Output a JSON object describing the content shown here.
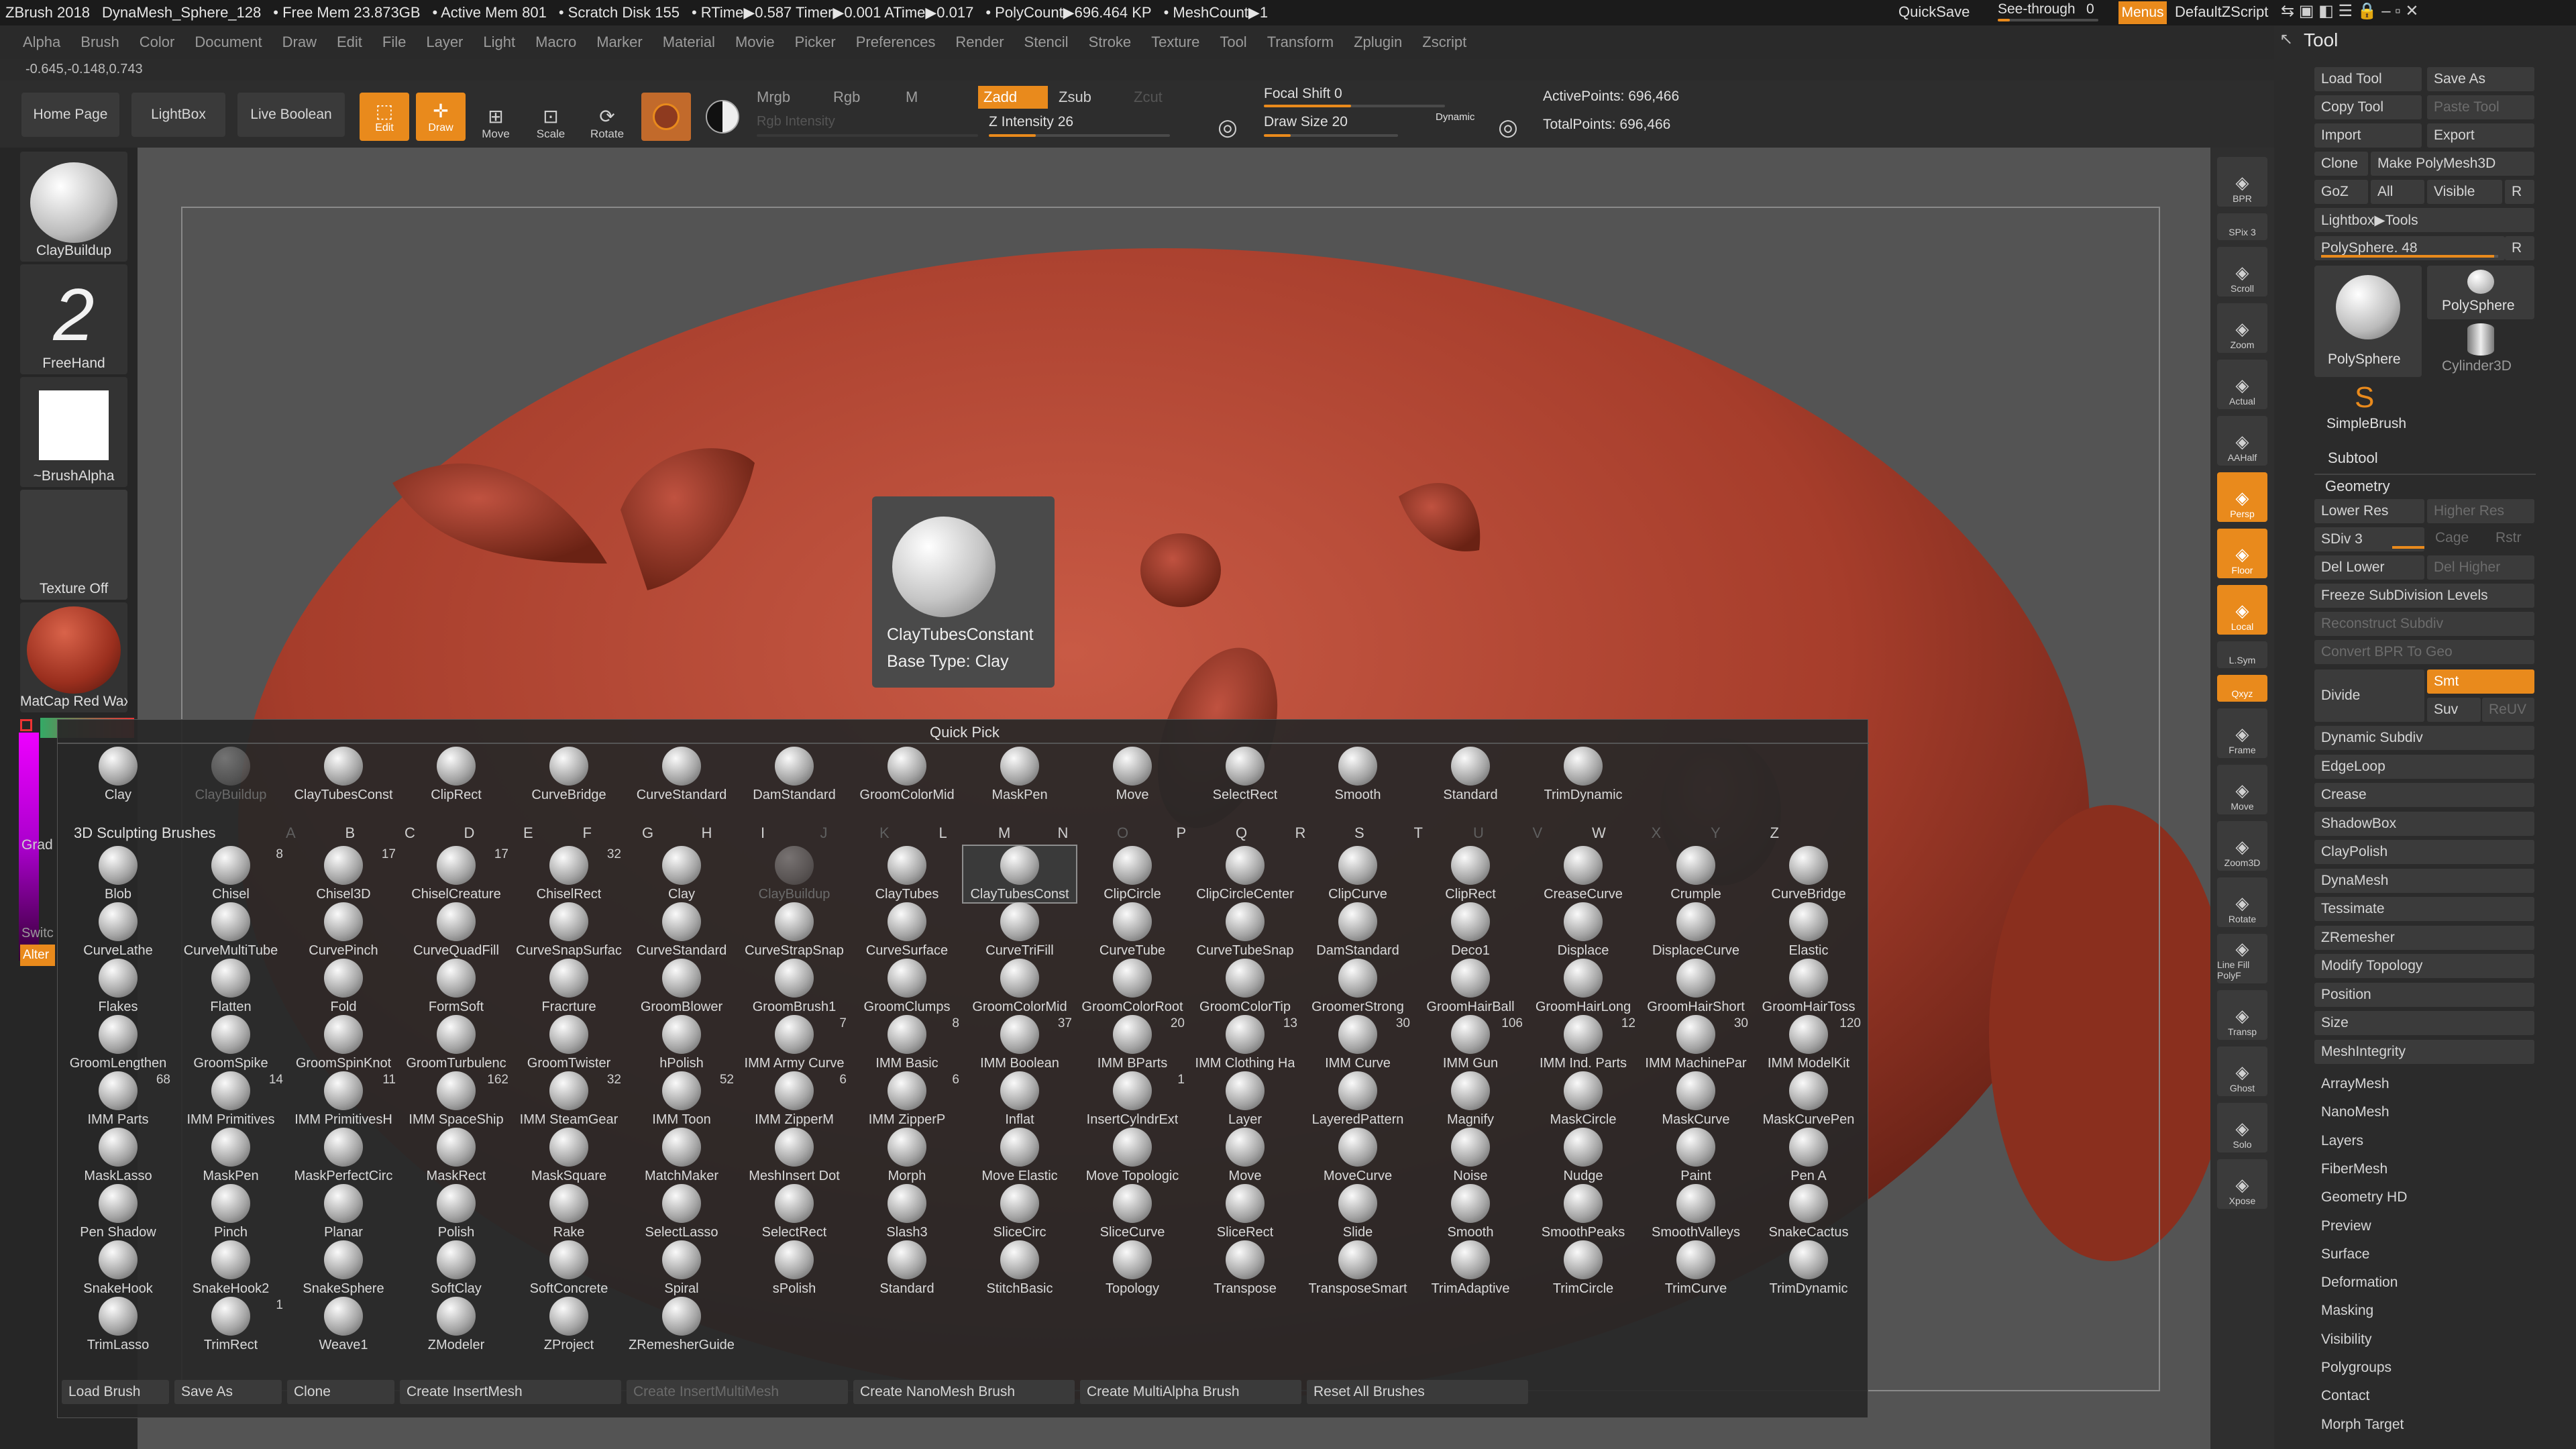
{
  "title": {
    "app": "ZBrush 2018",
    "doc": "DynaMesh_Sphere_128",
    "stats": [
      "• Free Mem 23.873GB",
      "• Active Mem 801",
      "• Scratch Disk 155",
      "• RTime▶0.587 Timer▶0.001 ATime▶0.017",
      "• PolyCount▶696.464 KP",
      "• MeshCount▶1"
    ],
    "quicksave": "QuickSave",
    "seethrough": "See-through",
    "seethrough_val": "0",
    "menus": "Menus",
    "default_zscript": "DefaultZScript"
  },
  "menubar": [
    "Alpha",
    "Brush",
    "Color",
    "Document",
    "Draw",
    "Edit",
    "File",
    "Layer",
    "Light",
    "Macro",
    "Marker",
    "Material",
    "Movie",
    "Picker",
    "Preferences",
    "Render",
    "Stencil",
    "Stroke",
    "Texture",
    "Tool",
    "Transform",
    "Zplugin",
    "Zscript"
  ],
  "coords": "-0.645,-0.148,0.743",
  "shelf": {
    "home": "Home Page",
    "lightbox": "LightBox",
    "liveboolean": "Live Boolean",
    "edit": "Edit",
    "draw": "Draw",
    "move": "Move",
    "scale": "Scale",
    "rotate": "Rotate",
    "mrgb": "Mrgb",
    "rgb": "Rgb",
    "m": "M",
    "zadd": "Zadd",
    "zsub": "Zsub",
    "zcut": "Zcut",
    "rgb_intensity": "Rgb Intensity",
    "z_intensity": "Z Intensity 26",
    "z_intensity_value": 0.26,
    "focal_shift": "Focal Shift 0",
    "draw_size": "Draw Size 20",
    "dynamic": "Dynamic",
    "active_points": "ActivePoints: 696,466",
    "total_points": "TotalPoints: 696,466"
  },
  "left": [
    {
      "label": "ClayBuildup"
    },
    {
      "label": "FreeHand"
    },
    {
      "label": "~BrushAlpha"
    },
    {
      "label": "Texture Off"
    },
    {
      "label": "MatCap Red Wax"
    }
  ],
  "left_misc": {
    "grad": "Grad",
    "switch": "Switc",
    "alternate": "Alter"
  },
  "tooltip": {
    "name": "ClayTubesConstant",
    "base": "Base Type: Clay"
  },
  "quickpick": {
    "title": "Quick Pick",
    "items": [
      "Clay",
      "ClayBuildup",
      "ClayTubesConst",
      "ClipRect",
      "CurveBridge",
      "CurveStandard",
      "DamStandard",
      "GroomColorMid",
      "MaskPen",
      "Move",
      "SelectRect",
      "Smooth",
      "Standard",
      "TrimDynamic"
    ]
  },
  "brushes": {
    "title": "3D Sculpting Brushes",
    "letters": [
      "A",
      "B",
      "C",
      "D",
      "E",
      "F",
      "G",
      "H",
      "I",
      "J",
      "K",
      "L",
      "M",
      "N",
      "O",
      "P",
      "Q",
      "R",
      "S",
      "T",
      "U",
      "V",
      "W",
      "X",
      "Y",
      "Z"
    ],
    "dim_letters": [
      "A",
      "J",
      "K",
      "O",
      "U",
      "V",
      "X",
      "Y"
    ],
    "rows": [
      [
        [
          "Blob",
          ""
        ],
        [
          "Chisel",
          "8"
        ],
        [
          "Chisel3D",
          "17"
        ],
        [
          "ChiselCreature",
          "17"
        ],
        [
          "ChiselRect",
          "32"
        ],
        [
          "Clay",
          ""
        ],
        [
          "ClayBuildup",
          ""
        ],
        [
          "ClayTubes",
          ""
        ],
        [
          "ClayTubesConst",
          ""
        ],
        [
          "ClipCircle",
          ""
        ],
        [
          "ClipCircleCenter",
          ""
        ],
        [
          "ClipCurve",
          ""
        ],
        [
          "ClipRect",
          ""
        ],
        [
          "CreaseCurve",
          ""
        ],
        [
          "Crumple",
          ""
        ],
        [
          "CurveBridge",
          ""
        ]
      ],
      [
        [
          "CurveLathe",
          ""
        ],
        [
          "CurveMultiTube",
          ""
        ],
        [
          "CurvePinch",
          ""
        ],
        [
          "CurveQuadFill",
          ""
        ],
        [
          "CurveSnapSurfac",
          ""
        ],
        [
          "CurveStandard",
          ""
        ],
        [
          "CurveStrapSnap",
          ""
        ],
        [
          "CurveSurface",
          ""
        ],
        [
          "CurveTriFill",
          ""
        ],
        [
          "CurveTube",
          ""
        ],
        [
          "CurveTubeSnap",
          ""
        ],
        [
          "DamStandard",
          ""
        ],
        [
          "Deco1",
          ""
        ],
        [
          "Displace",
          ""
        ],
        [
          "DisplaceCurve",
          ""
        ],
        [
          "Elastic",
          ""
        ]
      ],
      [
        [
          "Flakes",
          ""
        ],
        [
          "Flatten",
          ""
        ],
        [
          "Fold",
          ""
        ],
        [
          "FormSoft",
          ""
        ],
        [
          "Fracrture",
          ""
        ],
        [
          "GroomBlower",
          ""
        ],
        [
          "GroomBrush1",
          ""
        ],
        [
          "GroomClumps",
          ""
        ],
        [
          "GroomColorMid",
          ""
        ],
        [
          "GroomColorRoot",
          ""
        ],
        [
          "GroomColorTip",
          ""
        ],
        [
          "GroomerStrong",
          ""
        ],
        [
          "GroomHairBall",
          ""
        ],
        [
          "GroomHairLong",
          ""
        ],
        [
          "GroomHairShort",
          ""
        ],
        [
          "GroomHairToss",
          ""
        ]
      ],
      [
        [
          "GroomLengthen",
          ""
        ],
        [
          "GroomSpike",
          ""
        ],
        [
          "GroomSpinKnot",
          ""
        ],
        [
          "GroomTurbulenc",
          ""
        ],
        [
          "GroomTwister",
          ""
        ],
        [
          "hPolish",
          ""
        ],
        [
          "IMM Army Curve",
          "7"
        ],
        [
          "IMM Basic",
          "8"
        ],
        [
          "IMM Boolean",
          "37"
        ],
        [
          "IMM BParts",
          "20"
        ],
        [
          "IMM Clothing Ha",
          "13"
        ],
        [
          "IMM Curve",
          "30"
        ],
        [
          "IMM Gun",
          "106"
        ],
        [
          "IMM Ind. Parts",
          "12"
        ],
        [
          "IMM MachinePar",
          "30"
        ],
        [
          "IMM ModelKit",
          "120"
        ]
      ],
      [
        [
          "IMM Parts",
          "68"
        ],
        [
          "IMM Primitives",
          "14"
        ],
        [
          "IMM PrimitivesH",
          "11"
        ],
        [
          "IMM SpaceShip",
          "162"
        ],
        [
          "IMM SteamGear",
          "32"
        ],
        [
          "IMM Toon",
          "52"
        ],
        [
          "IMM ZipperM",
          "6"
        ],
        [
          "IMM ZipperP",
          "6"
        ],
        [
          "Inflat",
          ""
        ],
        [
          "InsertCylndrExt",
          "1"
        ],
        [
          "Layer",
          ""
        ],
        [
          "LayeredPattern",
          ""
        ],
        [
          "Magnify",
          ""
        ],
        [
          "MaskCircle",
          ""
        ],
        [
          "MaskCurve",
          ""
        ],
        [
          "MaskCurvePen",
          ""
        ]
      ],
      [
        [
          "MaskLasso",
          ""
        ],
        [
          "MaskPen",
          ""
        ],
        [
          "MaskPerfectCirc",
          ""
        ],
        [
          "MaskRect",
          ""
        ],
        [
          "MaskSquare",
          ""
        ],
        [
          "MatchMaker",
          ""
        ],
        [
          "MeshInsert Dot",
          ""
        ],
        [
          "Morph",
          ""
        ],
        [
          "Move Elastic",
          ""
        ],
        [
          "Move Topologic",
          ""
        ],
        [
          "Move",
          ""
        ],
        [
          "MoveCurve",
          ""
        ],
        [
          "Noise",
          ""
        ],
        [
          "Nudge",
          ""
        ],
        [
          "Paint",
          ""
        ],
        [
          "Pen A",
          ""
        ]
      ],
      [
        [
          "Pen Shadow",
          ""
        ],
        [
          "Pinch",
          ""
        ],
        [
          "Planar",
          ""
        ],
        [
          "Polish",
          ""
        ],
        [
          "Rake",
          ""
        ],
        [
          "SelectLasso",
          ""
        ],
        [
          "SelectRect",
          ""
        ],
        [
          "Slash3",
          ""
        ],
        [
          "SliceCirc",
          ""
        ],
        [
          "SliceCurve",
          ""
        ],
        [
          "SliceRect",
          ""
        ],
        [
          "Slide",
          ""
        ],
        [
          "Smooth",
          ""
        ],
        [
          "SmoothPeaks",
          ""
        ],
        [
          "SmoothValleys",
          ""
        ],
        [
          "SnakeCactus",
          ""
        ]
      ],
      [
        [
          "SnakeHook",
          ""
        ],
        [
          "SnakeHook2",
          ""
        ],
        [
          "SnakeSphere",
          ""
        ],
        [
          "SoftClay",
          ""
        ],
        [
          "SoftConcrete",
          ""
        ],
        [
          "Spiral",
          ""
        ],
        [
          "sPolish",
          ""
        ],
        [
          "Standard",
          ""
        ],
        [
          "StitchBasic",
          ""
        ],
        [
          "Topology",
          ""
        ],
        [
          "Transpose",
          ""
        ],
        [
          "TransposeSmart",
          ""
        ],
        [
          "TrimAdaptive",
          ""
        ],
        [
          "TrimCircle",
          ""
        ],
        [
          "TrimCurve",
          ""
        ],
        [
          "TrimDynamic",
          ""
        ]
      ],
      [
        [
          "TrimLasso",
          ""
        ],
        [
          "TrimRect",
          "1"
        ],
        [
          "Weave1",
          ""
        ],
        [
          "ZModeler",
          ""
        ],
        [
          "ZProject",
          ""
        ],
        [
          "ZRemesherGuide",
          ""
        ]
      ]
    ]
  },
  "popup_buttons": [
    "Load Brush",
    "Save As",
    "Clone",
    "Create InsertMesh",
    "Create InsertMultiMesh",
    "Create NanoMesh Brush",
    "Create MultiAlpha Brush",
    "Reset All Brushes"
  ],
  "rightbar": [
    "BPR",
    "SPix 3",
    "Scroll",
    "Zoom",
    "Actual",
    "AAHalf",
    "Persp",
    "Floor",
    "Local",
    "L.Sym",
    "Qxyz",
    "Frame",
    "Move",
    "Zoom3D",
    "Rotate",
    "Line Fill PolyF",
    "Transp",
    "Ghost",
    "Solo",
    "Xpose"
  ],
  "tool": {
    "title": "Tool",
    "load_tool": "Load Tool",
    "save_as": "Save As",
    "copy_tool": "Copy Tool",
    "paste_tool": "Paste Tool",
    "import": "Import",
    "export": "Export",
    "clone": "Clone",
    "make_polymesh": "Make PolyMesh3D",
    "goz": "GoZ",
    "all": "All",
    "visible": "Visible",
    "r": "R",
    "lightbox_tools": "Lightbox▶Tools",
    "polysphere_slider": "PolySphere. 48",
    "thumbs": [
      "PolySphere",
      "PolySphere",
      "Cylinder3D",
      "SimpleBrush"
    ],
    "subtool": "Subtool",
    "geometry": "Geometry",
    "lower_res": "Lower Res",
    "higher_res": "Higher Res",
    "sdiv": "SDiv 3",
    "cage": "Cage",
    "rstr": "Rstr",
    "del_lower": "Del Lower",
    "del_higher": "Del Higher",
    "freeze": "Freeze SubDivision Levels",
    "reconstruct": "Reconstruct Subdiv",
    "convert_bpr": "Convert BPR To Geo",
    "divide": "Divide",
    "smt": "Smt",
    "suv": "Suv",
    "reuv": "ReUV",
    "geo_items": [
      "Dynamic Subdiv",
      "EdgeLoop",
      "Crease",
      "ShadowBox",
      "ClayPolish",
      "DynaMesh",
      "Tessimate",
      "ZRemesher",
      "Modify Topology",
      "Position",
      "Size",
      "MeshIntegrity"
    ],
    "sections": [
      "ArrayMesh",
      "NanoMesh",
      "Layers",
      "FiberMesh",
      "Geometry HD",
      "Preview",
      "Surface",
      "Deformation",
      "Masking",
      "Visibility",
      "Polygroups",
      "Contact",
      "Morph Target"
    ]
  },
  "colors": {
    "accent": "#e98a1c",
    "clay": "#b64a38"
  }
}
